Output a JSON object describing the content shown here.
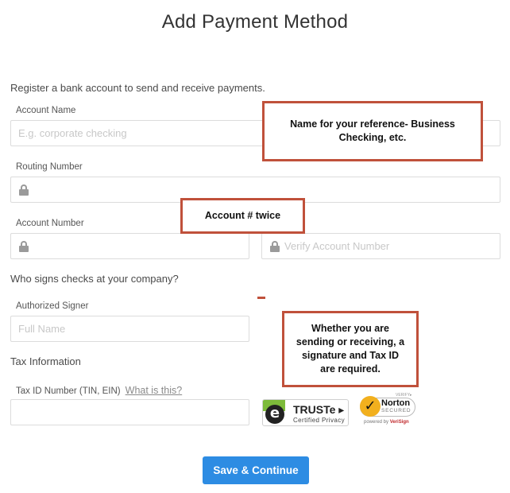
{
  "page": {
    "title": "Add Payment Method",
    "intro": "Register a bank account to send and receive payments."
  },
  "form": {
    "account_name": {
      "label": "Account Name",
      "placeholder": "E.g. corporate checking",
      "value": ""
    },
    "routing_number": {
      "label": "Routing Number",
      "placeholder": "",
      "value": "",
      "icon": "lock-icon"
    },
    "account_number": {
      "label": "Account Number",
      "placeholder": "",
      "value": "",
      "icon": "lock-icon"
    },
    "verify_account_number": {
      "placeholder": "Verify Account Number",
      "value": "",
      "icon": "lock-icon"
    },
    "signer_section": "Who signs checks at your company?",
    "authorized_signer": {
      "label": "Authorized Signer",
      "placeholder": "Full Name",
      "value": ""
    },
    "tax_section": "Tax Information",
    "tax_id": {
      "label": "Tax ID Number (TIN, EIN)",
      "help_link": "What is this?",
      "placeholder": "",
      "value": ""
    },
    "submit_label": "Save & Continue"
  },
  "annotations": {
    "account_name_note": "Name for your reference- Business Checking, etc.",
    "account_number_note": "Account # twice",
    "requirements_note": "Whether you are sending or receiving, a signature and Tax ID are required."
  },
  "badges": {
    "truste": {
      "brand": "TRUSTe ▸",
      "subtitle": "Certified Privacy",
      "logo_glyph": "e"
    },
    "norton": {
      "verify": "VERIFY▸",
      "name": "Norton",
      "secured": "SECURED",
      "powered_by": "powered by",
      "powered_brand": "VeriSign",
      "check_glyph": "✓"
    }
  },
  "colors": {
    "primary_button": "#2d8ce3",
    "annotation_border": "#c0513b",
    "input_border": "#dcdcdc",
    "truste_green": "#7dbb3a",
    "norton_yellow": "#f2b01e"
  }
}
